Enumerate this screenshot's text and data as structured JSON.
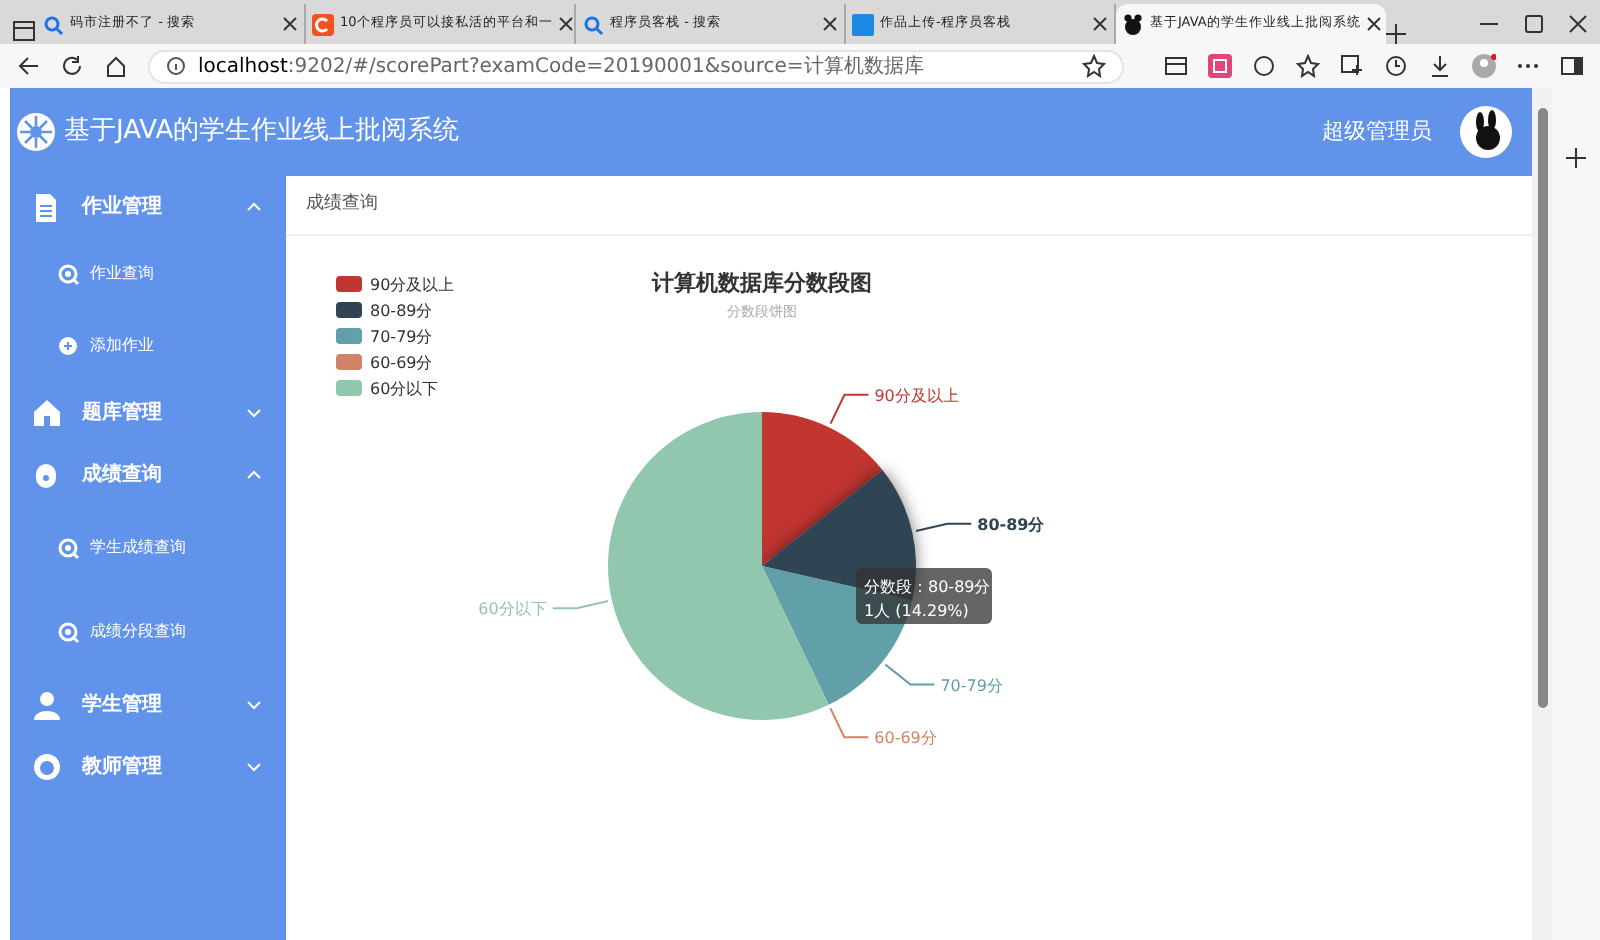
{
  "browser": {
    "tabs": [
      {
        "title": "码市注册不了 - 搜索",
        "selected": false
      },
      {
        "title": "10个程序员可以接私活的平台和一",
        "selected": false
      },
      {
        "title": "程序员客栈 - 搜索",
        "selected": false
      },
      {
        "title": "作品上传-程序员客栈",
        "selected": false
      },
      {
        "title": "基于JAVA的学生作业线上批阅系统",
        "selected": true
      }
    ],
    "url_host": "localhost",
    "url_rest": ":9202/#/scorePart?examCode=20190001&source=计算机数据库"
  },
  "header": {
    "title": "基于JAVA的学生作业线上批阅系统",
    "user": "超级管理员"
  },
  "sidebar": {
    "items": [
      {
        "label": "作业管理",
        "expanded": true,
        "children": [
          {
            "label": "作业查询"
          },
          {
            "label": "添加作业"
          }
        ]
      },
      {
        "label": "题库管理",
        "expanded": false
      },
      {
        "label": "成绩查询",
        "expanded": true,
        "children": [
          {
            "label": "学生成绩查询"
          },
          {
            "label": "成绩分段查询"
          }
        ]
      },
      {
        "label": "学生管理",
        "expanded": false
      },
      {
        "label": "教师管理",
        "expanded": false
      }
    ]
  },
  "breadcrumb": "成绩查询",
  "chart": {
    "chart_data": {
      "type": "pie",
      "title": "计算机数据库分数段图",
      "legend": "top-left",
      "categories": [
        "90分及以上",
        "80-89分",
        "70-79分",
        "60-69分",
        "60分以下"
      ],
      "values": [
        14.29,
        14.29,
        14.29,
        0,
        57.13
      ]
    },
    "subtitle": "分数段饼图",
    "slices": [
      {
        "highlighted": false
      },
      {
        "highlighted": true
      },
      {
        "highlighted": false
      },
      {
        "highlighted": false
      },
      {
        "highlighted": false
      }
    ],
    "tooltip": {
      "title": "分数段：80-89分",
      "text": "1人 (14.29%)"
    }
  }
}
